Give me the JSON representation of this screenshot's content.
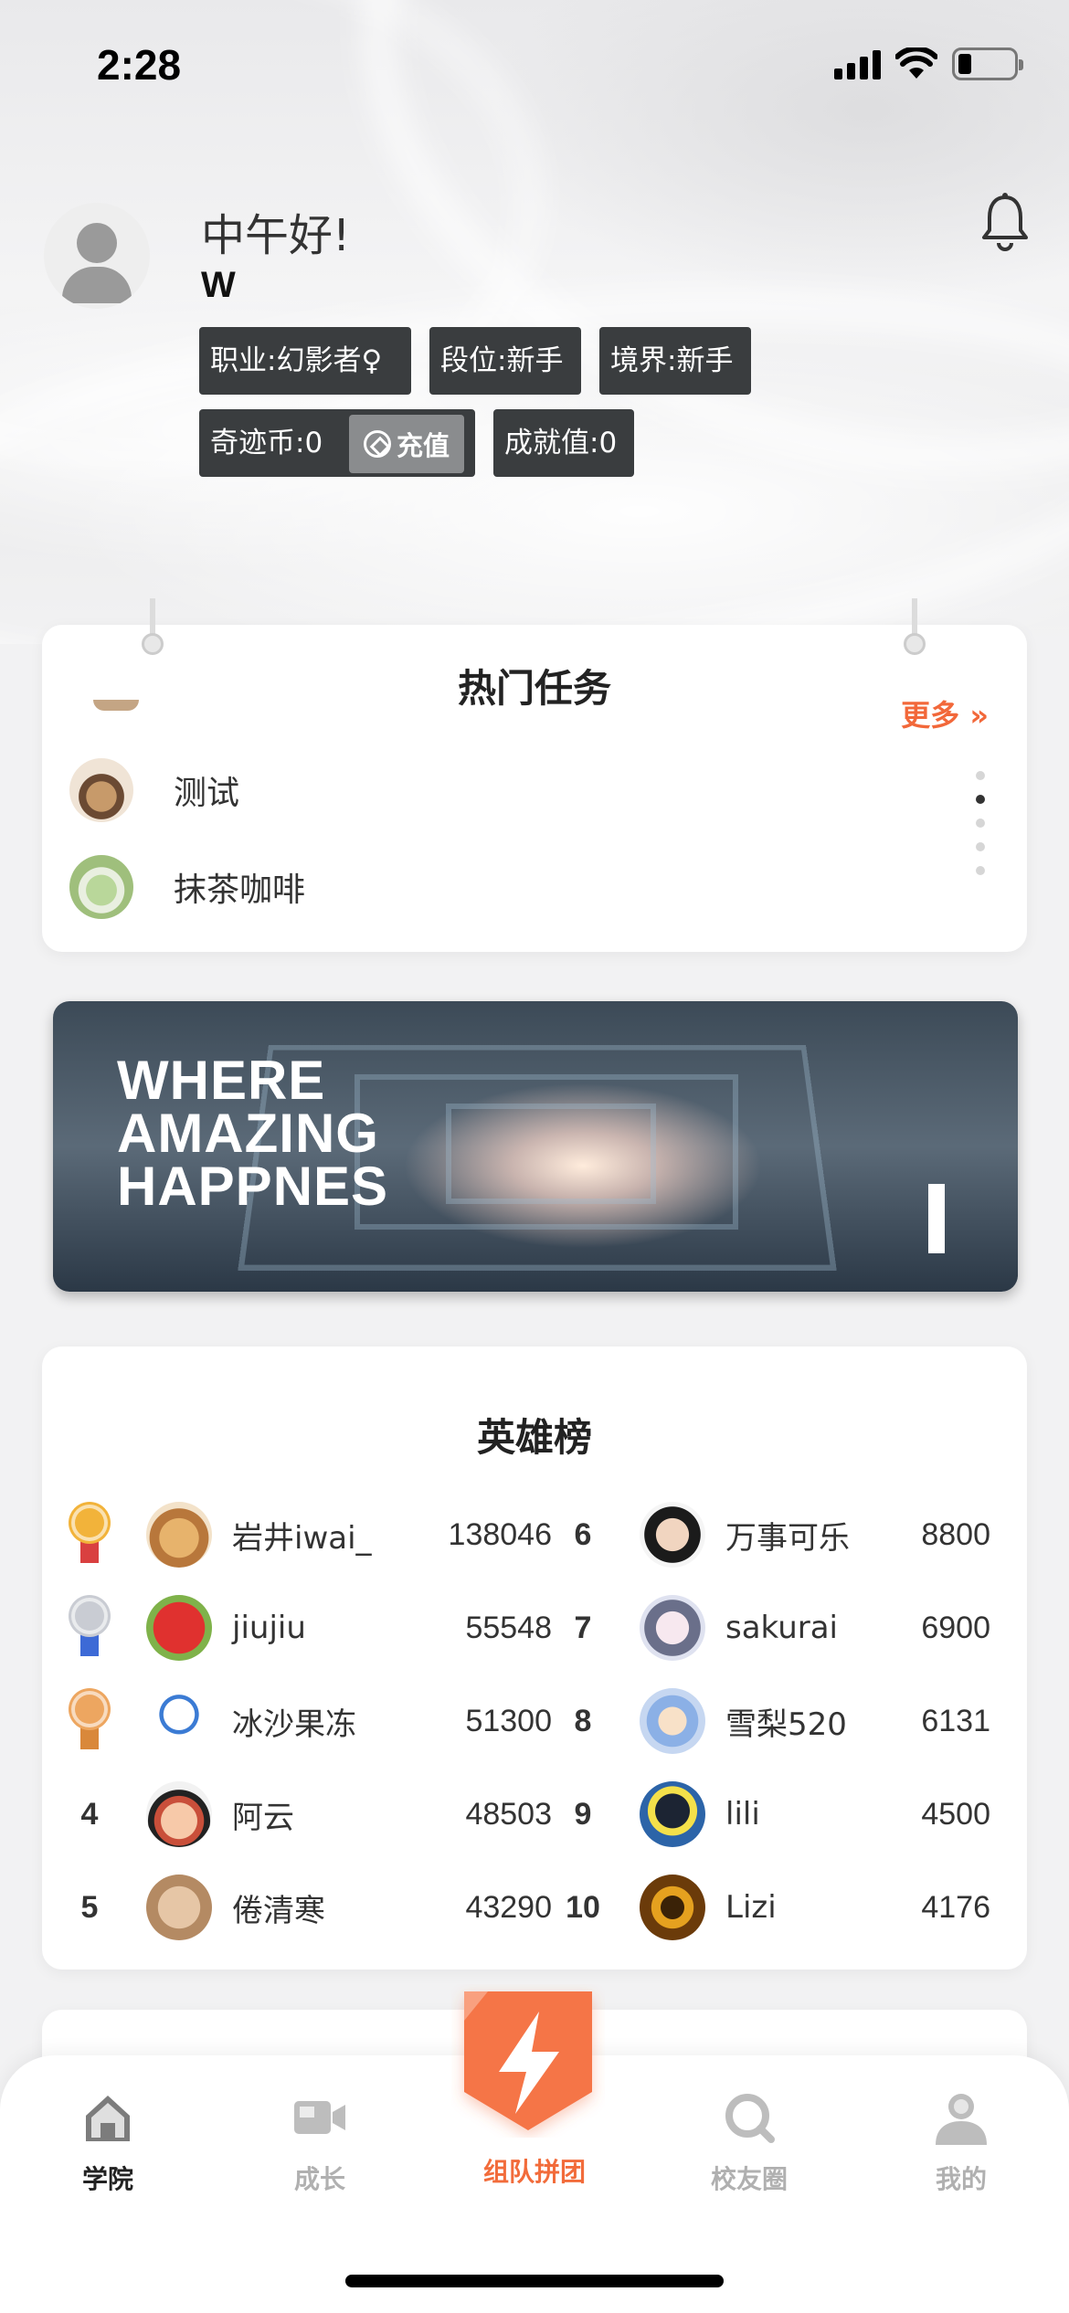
{
  "status_bar": {
    "time": "2:28"
  },
  "profile": {
    "greeting": "中午好!",
    "username": "W",
    "tags": {
      "occupation": "职业:幻影者♀",
      "rank": "段位:新手",
      "realm": "境界:新手",
      "coins": "奇迹币:0",
      "recharge": "充值",
      "achievement": "成就值:0"
    }
  },
  "hot_tasks": {
    "title": "热门任务",
    "more": "更多 »",
    "items": [
      {
        "label": "测试"
      },
      {
        "label": "抹茶咖啡"
      }
    ]
  },
  "banner": {
    "lines": [
      "WHERE",
      "AMAZING",
      "HAPPNES"
    ]
  },
  "leaderboard": {
    "title": "英雄榜",
    "left": [
      {
        "rank": "1",
        "name": "岩井iwai_",
        "score": "138046",
        "medal": "gold"
      },
      {
        "rank": "2",
        "name": "jiujiu",
        "score": "55548",
        "medal": "silver"
      },
      {
        "rank": "3",
        "name": "冰沙果冻",
        "score": "51300",
        "medal": "bronze"
      },
      {
        "rank": "4",
        "name": "阿云",
        "score": "48503"
      },
      {
        "rank": "5",
        "name": "倦清寒",
        "score": "43290"
      }
    ],
    "right": [
      {
        "rank": "6",
        "name": "万事可乐",
        "score": "8800"
      },
      {
        "rank": "7",
        "name": "sakurai",
        "score": "6900"
      },
      {
        "rank": "8",
        "name": "雪梨520",
        "score": "6131"
      },
      {
        "rank": "9",
        "name": "lili",
        "score": "4500"
      },
      {
        "rank": "10",
        "name": "Lizi",
        "score": "4176"
      }
    ]
  },
  "tabbar": {
    "items": [
      {
        "label": "学院",
        "icon": "home-icon",
        "active": true
      },
      {
        "label": "成长",
        "icon": "video-camera-icon"
      },
      {
        "label": "组队拼团",
        "icon": "lightning-badge-icon",
        "highlight": true
      },
      {
        "label": "校友圈",
        "icon": "search-circle-icon"
      },
      {
        "label": "我的",
        "icon": "user-icon"
      }
    ]
  },
  "colors": {
    "accent": "#f26c3b",
    "tag_bg": "#3a3d3f",
    "text": "#333333"
  }
}
